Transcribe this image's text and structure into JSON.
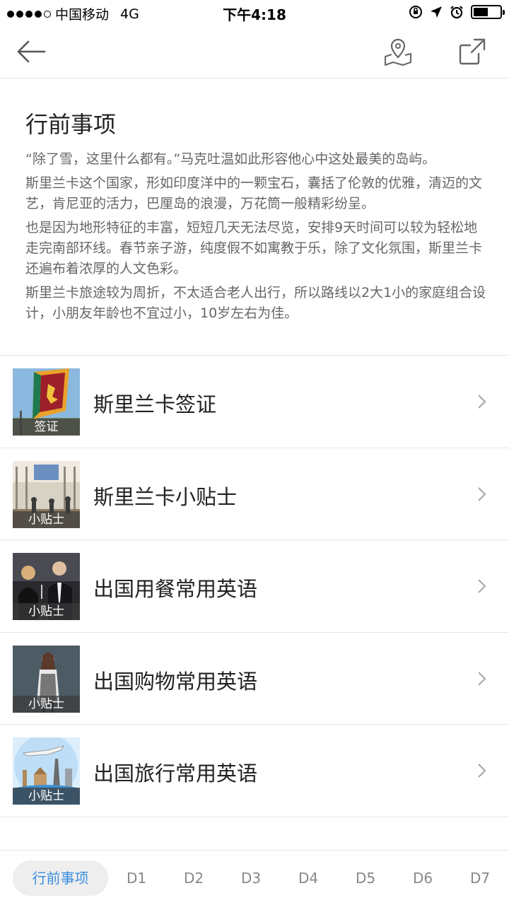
{
  "status_bar": {
    "carrier": "中国移动",
    "network": "4G",
    "time": "下午4:18",
    "battery_level": 0.55
  },
  "nav": {
    "back_icon": "back-arrow-icon",
    "map_icon": "map-pin-icon",
    "share_icon": "share-icon"
  },
  "intro": {
    "title": "行前事项",
    "paragraphs": [
      "“除了雪，这里什么都有。”马克吐温如此形容他心中这处最美的岛屿。",
      "斯里兰卡这个国家，形如印度洋中的一颗宝石，囊括了伦敦的优雅，清迈的文艺，肯尼亚的活力，巴厘岛的浪漫，万花筒一般精彩纷呈。",
      "也是因为地形特征的丰富，短短几天无法尽览，安排9天时间可以较为轻松地走完南部环线。春节亲子游，纯度假不如寓教于乐，除了文化氛围，斯里兰卡还遍布着浓厚的人文色彩。",
      "斯里兰卡旅途较为周折，不太适合老人出行，所以路线以2大1小的家庭组合设计，小朋友年龄也不宜过小，10岁左右为佳。"
    ]
  },
  "items": [
    {
      "title": "斯里兰卡签证",
      "tag": "签证"
    },
    {
      "title": "斯里兰卡小贴士",
      "tag": "小贴士"
    },
    {
      "title": "出国用餐常用英语",
      "tag": "小贴士"
    },
    {
      "title": "出国购物常用英语",
      "tag": "小贴士"
    },
    {
      "title": "出国旅行常用英语",
      "tag": "小贴士"
    }
  ],
  "tabs": [
    "行前事项",
    "D1",
    "D2",
    "D3",
    "D4",
    "D5",
    "D6",
    "D7"
  ],
  "colors": {
    "accent": "#3b8fe0",
    "divider": "#e6e6e6",
    "body_text": "#666666"
  }
}
